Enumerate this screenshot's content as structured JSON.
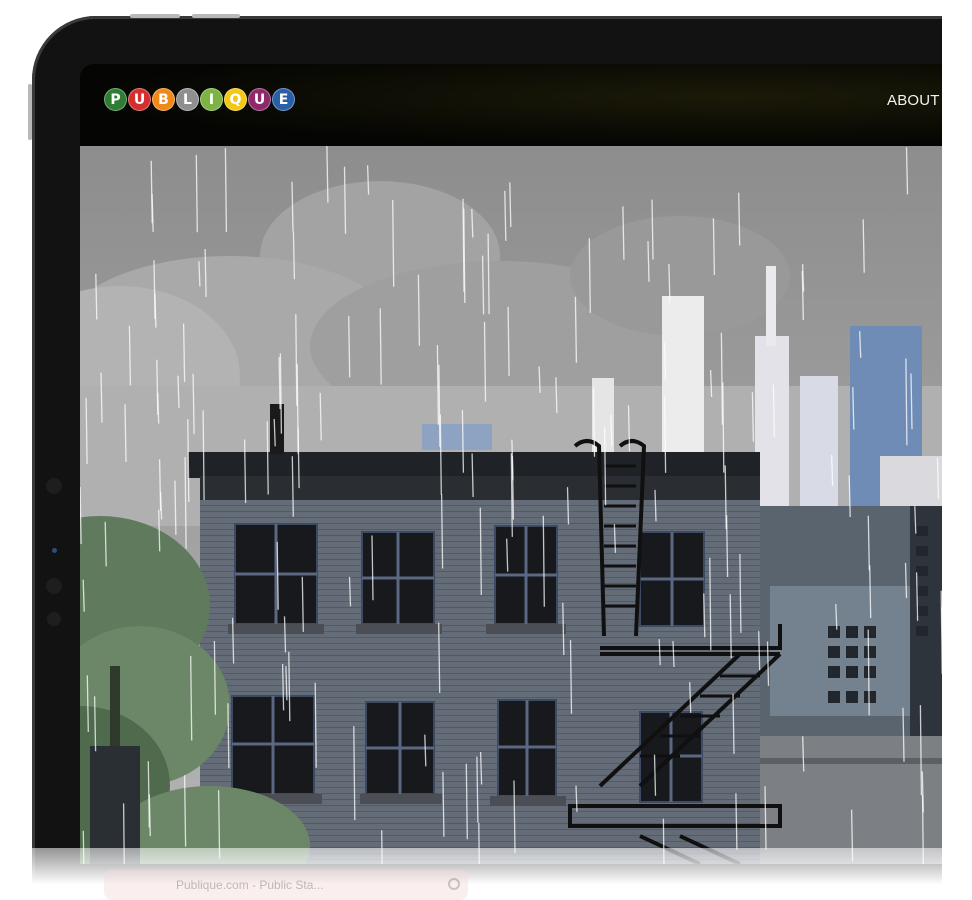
{
  "header": {
    "logo_letters": [
      {
        "char": "P",
        "color": "#2e7d32"
      },
      {
        "char": "U",
        "color": "#d32f2f"
      },
      {
        "char": "B",
        "color": "#ef8a1a"
      },
      {
        "char": "L",
        "color": "#8f8f8f"
      },
      {
        "char": "I",
        "color": "#7cb342"
      },
      {
        "char": "Q",
        "color": "#f2c814"
      },
      {
        "char": "U",
        "color": "#8e2a6b"
      },
      {
        "char": "E",
        "color": "#2a5fa8"
      }
    ],
    "nav": {
      "about_label": "ABOUT"
    },
    "background": "#050503"
  },
  "hero": {
    "illustration": "rainy-city-apartment-building",
    "sky_color": "#9a9a9a",
    "building_color": "#5f6670"
  },
  "device": {
    "frame_color": "#121212",
    "screen_accent": "#2c4e7a"
  },
  "reflection": {
    "text": "Publique.com - Public Sta..."
  }
}
